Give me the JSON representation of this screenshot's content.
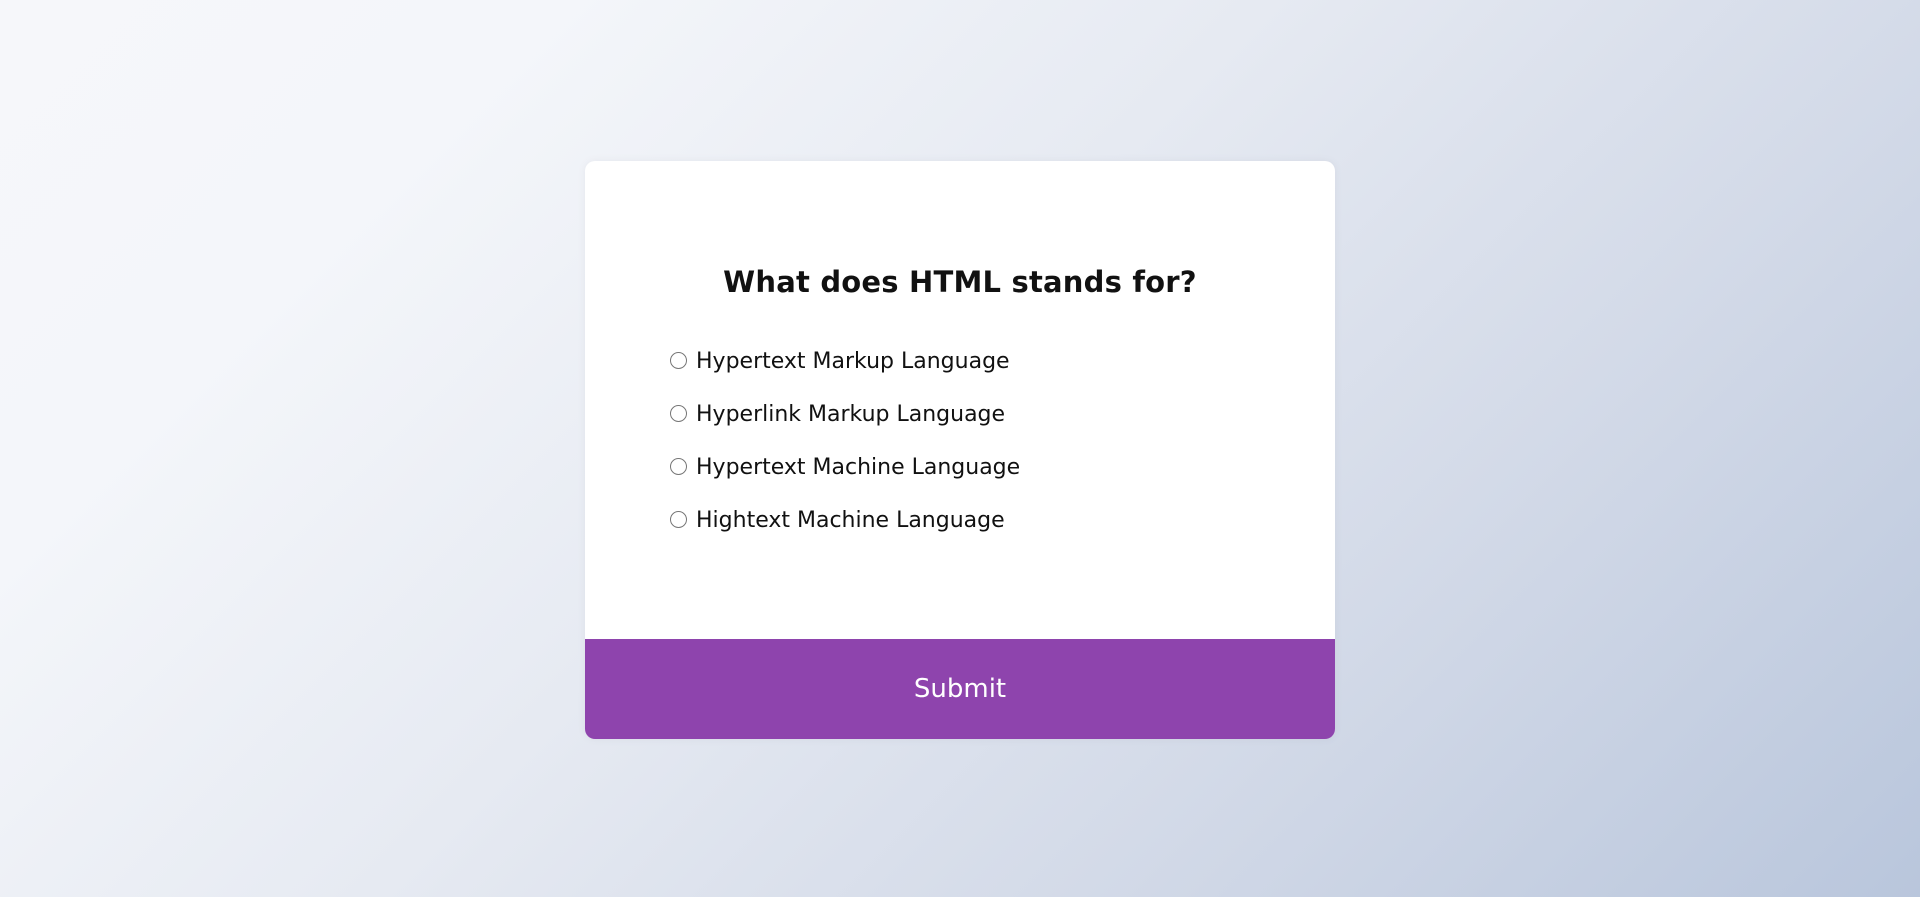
{
  "quiz": {
    "question": "What does HTML stands for?",
    "answers": [
      {
        "label": "Hypertext Markup Language",
        "selected": false
      },
      {
        "label": "Hyperlink Markup Language",
        "selected": false
      },
      {
        "label": "Hypertext Machine Language",
        "selected": false
      },
      {
        "label": "Hightext Machine Language",
        "selected": false
      }
    ],
    "submit_label": "Submit"
  },
  "colors": {
    "accent": "#8e44ad",
    "card_background": "#ffffff",
    "text": "#111111"
  }
}
